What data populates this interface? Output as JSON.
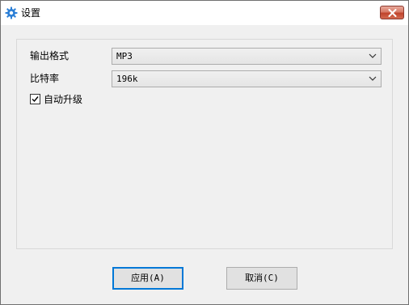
{
  "window": {
    "title": "设置",
    "icon": "gear-icon",
    "close_icon": "close-icon"
  },
  "form": {
    "format": {
      "label": "输出格式",
      "value": "MP3"
    },
    "bitrate": {
      "label": "比特率",
      "value": "196k"
    },
    "auto_upgrade": {
      "label": "自动升级",
      "checked": true
    }
  },
  "buttons": {
    "apply_label": "应用(A)",
    "cancel_label": "取消(C)"
  },
  "colors": {
    "accent": "#0078d7",
    "close_button": "#c0442c",
    "window_bg": "#f0f0f0"
  }
}
